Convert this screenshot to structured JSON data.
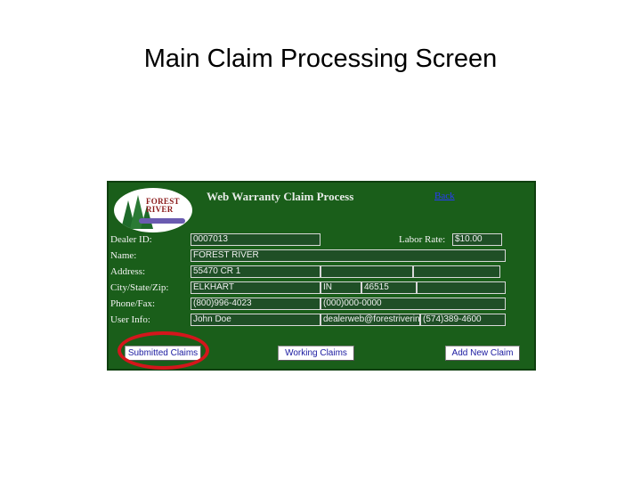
{
  "slide": {
    "title": "Main Claim Processing Screen"
  },
  "panel": {
    "title": "Web Warranty Claim Process",
    "back_label": "Back",
    "logo": {
      "icon": "forest-river-logo-icon",
      "text_line1": "FOREST",
      "text_line2": "RIVER"
    },
    "labels": {
      "dealer_id": "Dealer ID:",
      "name": "Name:",
      "address": "Address:",
      "city_state_zip": "City/State/Zip:",
      "phone_fax": "Phone/Fax:",
      "user_info": "User Info:",
      "labor_rate": "Labor Rate:"
    },
    "fields": {
      "dealer_id": "0007013",
      "labor_rate": "$10.00",
      "name": "FOREST RIVER",
      "address1": "55470 CR 1",
      "address2": "",
      "address3": "",
      "city": "ELKHART",
      "state": "IN",
      "zip": "46515",
      "zip_ext": "",
      "phone": "(800)996-4023",
      "fax": "(000)000-0000",
      "fax_ext": "",
      "user_name": "John Doe",
      "user_email": "dealerweb@forestriverinc",
      "user_phone": "(574)389-4600"
    },
    "buttons": {
      "submitted_claims": "Submitted Claims",
      "working_claims": "Working Claims",
      "add_new_claim": "Add New Claim"
    },
    "highlight_color": "#d4161c"
  }
}
